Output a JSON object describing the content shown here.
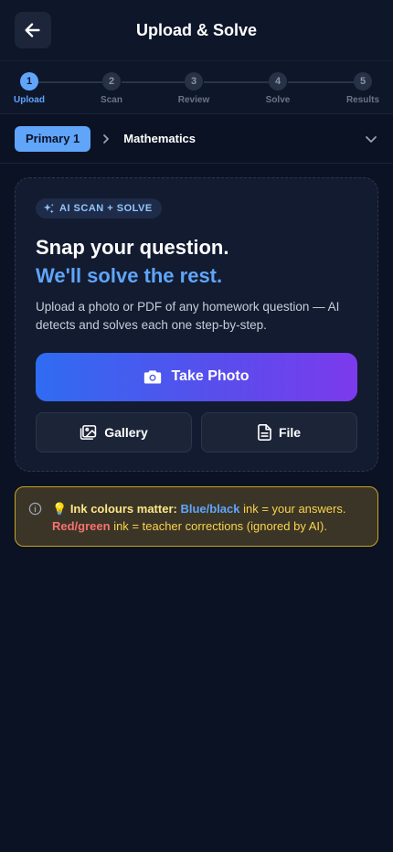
{
  "header": {
    "title": "Upload & Solve",
    "back_icon": "arrow-left-icon"
  },
  "stepper": {
    "current": 1,
    "steps": [
      {
        "number": "1",
        "label": "Upload"
      },
      {
        "number": "2",
        "label": "Scan"
      },
      {
        "number": "3",
        "label": "Review"
      },
      {
        "number": "4",
        "label": "Solve"
      },
      {
        "number": "5",
        "label": "Results"
      }
    ]
  },
  "subject_bar": {
    "level": "Primary 1",
    "subject": "Mathematics"
  },
  "card": {
    "badge": "AI SCAN + SOLVE",
    "headline_1": "Snap your question.",
    "headline_2": "We'll solve the rest.",
    "description": "Upload a photo or PDF of any homework question — AI detects and solves each one step-by-step.",
    "primary_button": "Take Photo",
    "gallery_button": "Gallery",
    "file_button": "File"
  },
  "notice": {
    "emoji": "💡",
    "title": "Ink colours matter:",
    "blue_label": "Blue/black",
    "blue_text": " ink = your answers.",
    "red_label": "Red/green",
    "red_text": " ink = teacher corrections (ignored by AI)."
  },
  "colors": {
    "background": "#0b1224",
    "accent": "#60a5fa",
    "gradient_start": "#2f6cf2",
    "gradient_end": "#7c3aed",
    "warning_border": "#c9a227",
    "warning_text": "#fcd34d"
  }
}
